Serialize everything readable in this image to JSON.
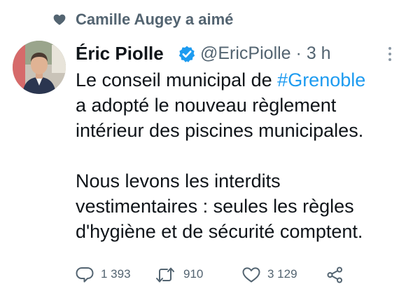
{
  "social_context": {
    "text": "Camille Augey a aimé",
    "icon": "heart-icon"
  },
  "tweet": {
    "author_name": "Éric Piolle",
    "verified": true,
    "handle": "@EricPiolle",
    "separator": "·",
    "time": "3 h",
    "text_lines": {
      "l1_prefix": "Le conseil municipal de ",
      "l1_hashtag": "#Grenoble",
      "l2": "a adopté le nouveau règlement",
      "l3": "intérieur des piscines municipales.",
      "l4": "Nous levons les interdits",
      "l5": "vestimentaires : seules les règles",
      "l6": "d'hygiène et de sécurité comptent."
    }
  },
  "actions": {
    "replies": "1 393",
    "retweets": "910",
    "likes": "3 129"
  },
  "colors": {
    "text_primary": "#0f1419",
    "text_secondary": "#536471",
    "accent": "#1d9bf0",
    "background": "#ffffff"
  },
  "icons": [
    "heart-icon",
    "verified-badge-icon",
    "more-icon",
    "reply-icon",
    "retweet-icon",
    "like-icon",
    "share-icon"
  ]
}
